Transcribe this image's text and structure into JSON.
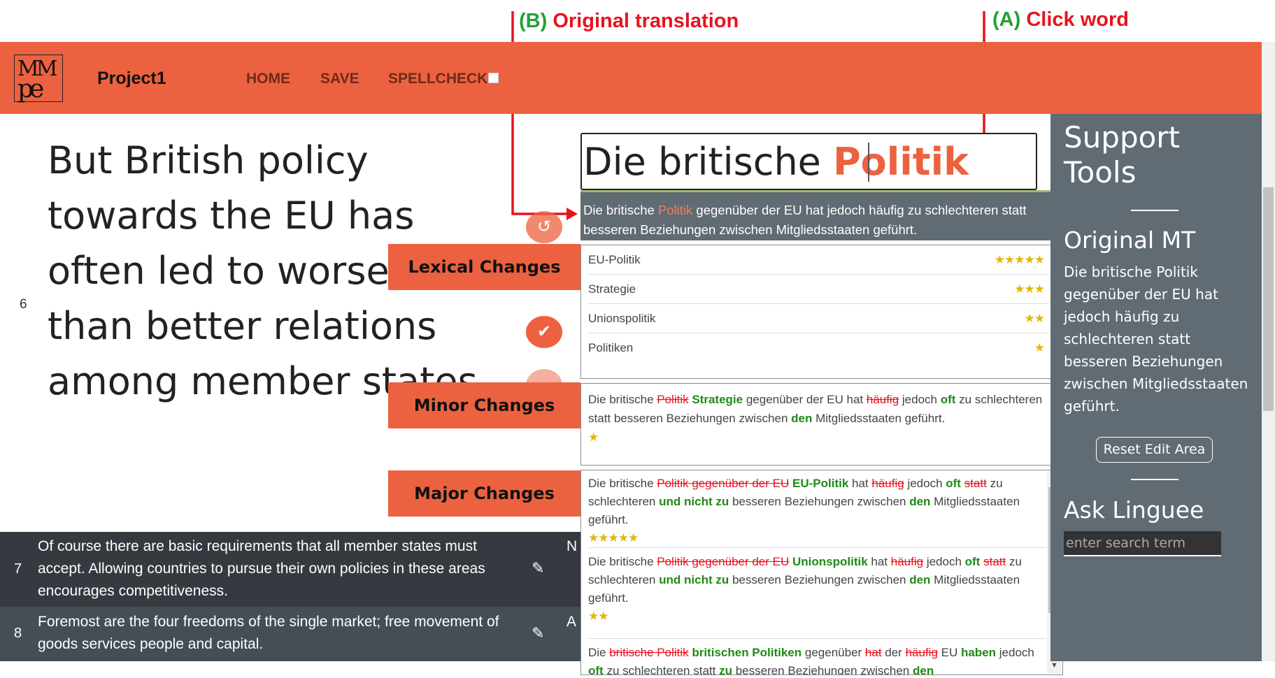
{
  "annotations": {
    "b_letter": "(B)",
    "b_text": "Original translation",
    "a_letter": "(A)",
    "a_text": "Click word"
  },
  "navbar": {
    "project": "Project1",
    "home": "HOME",
    "save": "SAVE",
    "spellcheck": "SPELLCHECK"
  },
  "segment6": {
    "number": "6",
    "source": "But British policy towards the EU has often led to worse rather than better relations among member states.",
    "target_prefix": "Die britische ",
    "target_word": "Politik"
  },
  "popup": {
    "sentence_prefix": "Die britische ",
    "sentence_word": "Politik",
    "sentence_suffix": " gegenüber der EU hat jedoch häufig zu schlechteren statt besseren Beziehungen zwischen Mitgliedsstaaten geführt.",
    "lexical": [
      {
        "word": "EU-Politik",
        "stars": "★★★★★"
      },
      {
        "word": "Strategie",
        "stars": "★★★"
      },
      {
        "word": "Unionspolitik",
        "stars": "★★"
      },
      {
        "word": "Politiken",
        "stars": "★"
      }
    ],
    "minor": {
      "t1": "Die britische ",
      "d1": "Politik",
      "i1": " Strategie",
      "t2": " gegenüber der EU hat ",
      "d2": "häufig",
      "t3": " jedoch ",
      "i2": "oft",
      "t4": " zu schlechteren statt besseren Beziehungen zwischen ",
      "i3": "den",
      "t5": " Mitgliedsstaaten geführt.",
      "stars": "★"
    },
    "major1": {
      "t1": "Die britische ",
      "d1": "Politik gegenüber der EU",
      "i1": " EU-Politik",
      "t2": " hat ",
      "d2": "häufig",
      "t3": " jedoch ",
      "i2": "oft",
      "t4": " ",
      "d3": "statt",
      "t5": " zu schlechteren ",
      "i3": "und nicht zu",
      "t6": " besseren Beziehungen zwischen ",
      "i4": "den",
      "t7": " Mitgliedsstaaten geführt.",
      "stars": "★★★★★"
    },
    "major2": {
      "t1": "Die britische ",
      "d1": "Politik gegenüber der EU",
      "i1": " Unionspolitik",
      "t2": " hat ",
      "d2": "häufig",
      "t3": " jedoch ",
      "i2": "oft",
      "t4": " ",
      "d3": "statt",
      "t5": " zu schlechteren ",
      "i3": "und nicht zu",
      "t6": " besseren Beziehungen zwischen ",
      "i4": "den",
      "t7": " Mitgliedsstaaten geführt.",
      "stars": "★★"
    },
    "major3": {
      "t1": "Die ",
      "d1": "britische Politik",
      "i1": " britischen Politiken",
      "t2": " gegenüber ",
      "d2": "hat",
      "t3": " der ",
      "d3": "häufig",
      "t4": " EU ",
      "i2": "haben",
      "t5": " jedoch ",
      "i3": "oft",
      "t6": " zu schlechteren statt ",
      "i4": "zu",
      "t7": " besseren Beziehungen zwischen ",
      "i5": "den"
    }
  },
  "labels": {
    "lexical": "Lexical Changes",
    "minor": "Minor Changes",
    "major": "Major Changes"
  },
  "support": {
    "title": "Support Tools",
    "mt_title": "Original MT",
    "mt_text": "Die britische Politik gegenüber der EU hat jedoch häufig zu schlechteren statt besseren Beziehungen zwischen Mitgliedsstaaten geführt.",
    "reset": "Reset Edit Area",
    "linguee_title": "Ask Linguee",
    "linguee_placeholder": "enter search term"
  },
  "rows": [
    {
      "number": "7",
      "source": "Of course there are basic requirements that all member states must accept. Allowing countries to pursue their own policies in these areas encourages competitiveness.",
      "target_clip": "N al B"
    },
    {
      "number": "8",
      "source": "Foremost are the four freedoms of the single market; free movement of goods services people and capital.",
      "target_clip": "A B"
    }
  ],
  "colors": {
    "brand": "#ec6240",
    "support_bg": "#616b73",
    "row_dark": "#343a40",
    "insert": "#1f8a17",
    "delete": "#e8131f",
    "star": "#e3b800"
  }
}
